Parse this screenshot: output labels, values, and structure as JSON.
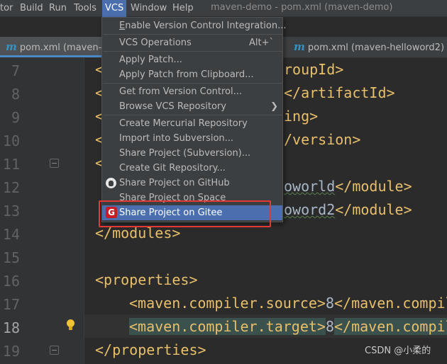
{
  "menubar": {
    "items": [
      "tor",
      "Build",
      "Run",
      "Tools",
      "VCS",
      "Window",
      "Help"
    ],
    "window_title": "maven-demo - pom.xml (maven-demo)"
  },
  "tabs": [
    {
      "label": "pom.xml (maven-de",
      "icon": "maven-icon",
      "active": true
    },
    {
      "label": "pom.xml (maven-helloword2)",
      "icon": "maven-icon",
      "active": false
    }
  ],
  "vcs_menu": {
    "items": [
      {
        "label": "Enable Version Control Integration...",
        "mnemonic": "E"
      },
      {
        "label": "VCS Operations",
        "shortcut": "Alt+`"
      },
      {
        "label": "Apply Patch..."
      },
      {
        "label": "Apply Patch from Clipboard..."
      },
      {
        "label": "Get from Version Control..."
      },
      {
        "label": "Browse VCS Repository",
        "submenu": true
      },
      {
        "label": "Create Mercurial Repository"
      },
      {
        "label": "Import into Subversion..."
      },
      {
        "label": "Share Project (Subversion)..."
      },
      {
        "label": "Create Git Repository..."
      },
      {
        "label": "Share Project on GitHub",
        "icon": "github-icon"
      },
      {
        "label": "Share Project on Space"
      },
      {
        "label": "Share Project on Gitee",
        "icon": "gitee-icon",
        "highlighted": true
      }
    ],
    "gitee_icon_letter": "G"
  },
  "editor": {
    "line_numbers": [
      "7",
      "8",
      "9",
      "10",
      "11",
      "12",
      "13",
      "14",
      "15",
      "16",
      "17",
      "18",
      "19"
    ],
    "current_line": "18",
    "fragments": {
      "l7_lt": "<",
      "l7": "roupId>",
      "l8_lt": "<",
      "l8": "</artifactId>",
      "l9_lt": "<",
      "l9": "ing>",
      "l10_lt": "<",
      "l10": "/version>",
      "l11_lt": "<",
      "l12_text": "oworld",
      "l12_tag": "</module>",
      "l13_text": "oword2",
      "l13_tag": "</module>",
      "l14": "</modules>",
      "l16": "<properties>",
      "l17_open": "<maven.compiler.source>",
      "l17_val": "8",
      "l17_close": "</maven.compil",
      "l18_open": "<maven.compiler.target>",
      "l18_val": "8",
      "l18_close": "</maven.compil",
      "l19": "</properties>"
    }
  },
  "watermark": "CSDN @小柔的",
  "colors": {
    "accent": "#4b6eaf",
    "tag": "#e8bf6a",
    "text": "#a9b7c6",
    "gitee": "#c71d23",
    "annotation_box": "#e53935"
  }
}
